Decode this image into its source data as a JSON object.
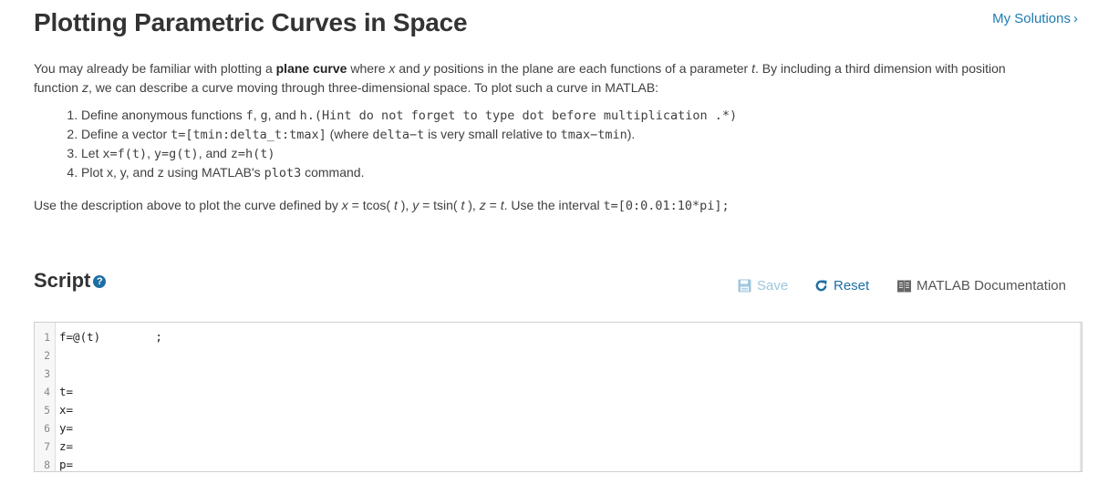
{
  "header": {
    "title": "Plotting Parametric Curves in Space",
    "my_solutions_label": "My Solutions",
    "my_solutions_chevron": "›"
  },
  "intro": {
    "p1_a": "You may already be familiar with plotting a ",
    "p1_bold": "plane curve",
    "p1_b": " where ",
    "p1_x": "x",
    "p1_c": " and ",
    "p1_y": "y",
    "p1_d": " positions in the plane are each functions of a parameter ",
    "p1_t": "t",
    "p1_e": ". By including a third dimension with position function ",
    "p1_z": "z",
    "p1_f": ", we can describe a curve moving through three-dimensional space. To plot such a curve in MATLAB:"
  },
  "steps": [
    {
      "a": "Define anonymous functions ",
      "m1": "f",
      "b": ", ",
      "m2": "g",
      "c": ", and ",
      "m3": "h.(Hint do not forget to type dot before multiplication .*)"
    },
    {
      "a": "Define a vector ",
      "m1": "t=[tmin:delta_t:tmax]",
      "b": " (where ",
      "m2": "delta−t",
      "c": " is very small relative to ",
      "m3": "tmax−tmin",
      "d": ")."
    },
    {
      "a": "Let ",
      "m1": "x=f(t)",
      "b": ", ",
      "m2": "y=g(t)",
      "c": ", and ",
      "m3": "z=h(t)"
    },
    {
      "a": "Plot x, y, and z using MATLAB's ",
      "m1": "plot3",
      "b": " command."
    }
  ],
  "task": {
    "a": "Use the description above to plot the curve defined by ",
    "x": "x",
    "b": " = tcos( ",
    "t1": "t",
    "c": " ), ",
    "y": "y",
    "d": " = tsin( ",
    "t2": "t",
    "e": " ), ",
    "z": "z",
    "f": " = ",
    "t3": "t",
    "g": ". Use the interval ",
    "interval": "t=[0:0.01:10*pi];"
  },
  "script": {
    "heading": "Script",
    "help_icon": "?",
    "save_label": "Save",
    "reset_label": "Reset",
    "docs_label": "MATLAB Documentation",
    "lines": [
      {
        "n": "1",
        "code": "f=@(t)        ;"
      },
      {
        "n": "2",
        "code": ""
      },
      {
        "n": "3",
        "code": ""
      },
      {
        "n": "4",
        "code": "t="
      },
      {
        "n": "5",
        "code": "x="
      },
      {
        "n": "6",
        "code": "y="
      },
      {
        "n": "7",
        "code": "z="
      },
      {
        "n": "8",
        "code": "p="
      }
    ]
  },
  "colors": {
    "link": "#1e7bb0",
    "reset": "#1e6fa3",
    "save_disabled": "#9fc6de",
    "help_icon": "#1e6fa3"
  }
}
